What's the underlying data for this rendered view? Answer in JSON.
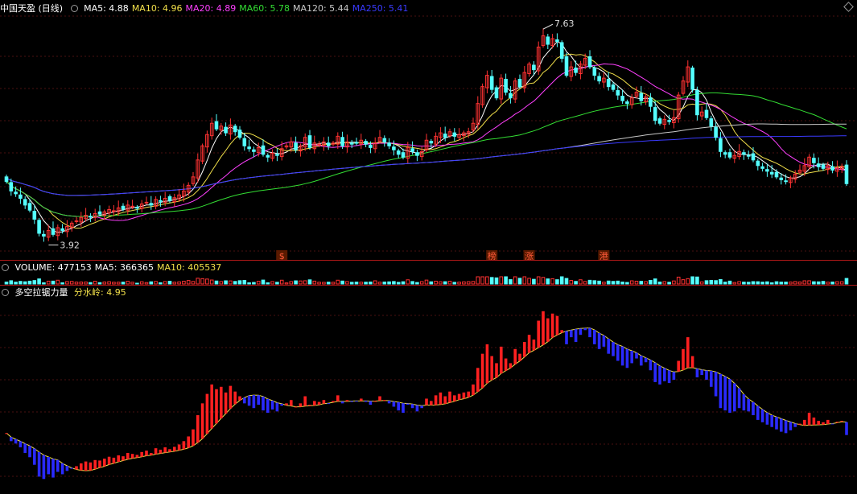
{
  "main_header": {
    "title": "中国天盈 (日线)",
    "items": [
      {
        "label": "MA5: 4.88",
        "color": "#ffffff"
      },
      {
        "label": "MA10: 4.96",
        "color": "#f2e04a"
      },
      {
        "label": "MA20: 4.89",
        "color": "#ff40ff"
      },
      {
        "label": "MA60: 5.78",
        "color": "#33dd33"
      },
      {
        "label": "MA120: 5.44",
        "color": "#c8c8c8"
      },
      {
        "label": "MA250: 5.41",
        "color": "#3a3aff"
      }
    ]
  },
  "volume_header": {
    "items": [
      {
        "label": "VOLUME: 477153",
        "color": "#ffffff"
      },
      {
        "label": "MA5: 366365",
        "color": "#ffffff"
      },
      {
        "label": "MA10: 405537",
        "color": "#f2e04a"
      }
    ]
  },
  "indicator_header": {
    "title": "多空拉锯力量",
    "items": [
      {
        "label": "分水岭: 4.95",
        "color": "#f2e04a"
      }
    ]
  },
  "chart_data": {
    "type": "candlestick",
    "price_high_label": "7.63",
    "price_low_label": "3.92",
    "event_markers": [
      {
        "text": "$",
        "index": 59
      },
      {
        "text": "榜",
        "index": 104
      },
      {
        "text": "涨",
        "index": 112
      },
      {
        "text": "港",
        "index": 128
      }
    ],
    "close": [
      4.92,
      4.75,
      4.7,
      4.62,
      4.5,
      4.41,
      4.25,
      4.0,
      3.95,
      4.05,
      3.98,
      4.1,
      4.05,
      4.12,
      4.18,
      4.22,
      4.28,
      4.32,
      4.3,
      4.35,
      4.34,
      4.38,
      4.42,
      4.4,
      4.45,
      4.43,
      4.5,
      4.48,
      4.46,
      4.52,
      4.55,
      4.5,
      4.6,
      4.57,
      4.62,
      4.58,
      4.63,
      4.68,
      4.75,
      4.85,
      5.0,
      5.3,
      5.55,
      5.75,
      5.95,
      5.85,
      5.9,
      5.78,
      5.92,
      5.8,
      5.7,
      5.55,
      5.5,
      5.45,
      5.52,
      5.4,
      5.35,
      5.42,
      5.38,
      5.5,
      5.55,
      5.62,
      5.48,
      5.55,
      5.7,
      5.52,
      5.6,
      5.58,
      5.62,
      5.55,
      5.6,
      5.72,
      5.55,
      5.62,
      5.58,
      5.6,
      5.65,
      5.58,
      5.52,
      5.6,
      5.7,
      5.62,
      5.55,
      5.48,
      5.4,
      5.35,
      5.52,
      5.45,
      5.38,
      5.45,
      5.65,
      5.6,
      5.72,
      5.78,
      5.7,
      5.8,
      5.72,
      5.75,
      5.78,
      5.8,
      5.95,
      6.3,
      6.6,
      6.8,
      6.55,
      6.4,
      6.75,
      6.5,
      6.4,
      6.7,
      6.6,
      6.85,
      7.0,
      6.9,
      7.3,
      7.5,
      7.35,
      7.45,
      7.4,
      7.1,
      6.8,
      6.95,
      6.85,
      7.0,
      7.1,
      6.95,
      6.8,
      6.7,
      6.75,
      6.6,
      6.55,
      6.45,
      6.35,
      6.3,
      6.4,
      6.5,
      6.35,
      6.42,
      6.25,
      6.0,
      5.95,
      6.02,
      5.98,
      6.05,
      6.45,
      6.7,
      6.95,
      6.55,
      6.1,
      6.15,
      6.05,
      5.9,
      5.7,
      5.45,
      5.4,
      5.35,
      5.38,
      5.45,
      5.4,
      5.38,
      5.3,
      5.2,
      5.15,
      5.1,
      5.05,
      5.0,
      4.95,
      4.92,
      4.98,
      5.05,
      5.12,
      5.2,
      5.35,
      5.25,
      5.18,
      5.15,
      5.2,
      5.12,
      5.16,
      5.18,
      4.88
    ],
    "indicator_watershed": 4.95
  }
}
